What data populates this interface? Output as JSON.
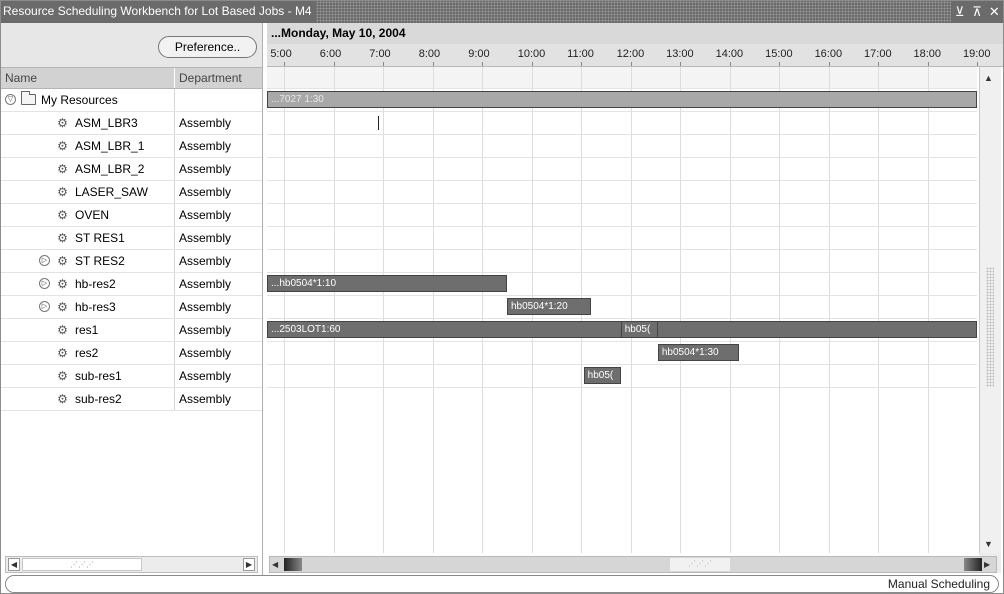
{
  "window": {
    "title": "Resource Scheduling Workbench for Lot Based Jobs - M4",
    "controls": {
      "minimize": "⊻",
      "maximize": "⊼",
      "close": "✕"
    }
  },
  "left_pane": {
    "preference_label": "Preference..",
    "columns": {
      "name": "Name",
      "department": "Department"
    },
    "root": {
      "label": "My Resources",
      "icon": "folder-icon"
    },
    "resources": [
      {
        "name": "ASM_LBR3",
        "department": "Assembly",
        "expandable": false
      },
      {
        "name": "ASM_LBR_1",
        "department": "Assembly",
        "expandable": false
      },
      {
        "name": "ASM_LBR_2",
        "department": "Assembly",
        "expandable": false
      },
      {
        "name": "LASER_SAW",
        "department": "Assembly",
        "expandable": false
      },
      {
        "name": "OVEN",
        "department": "Assembly",
        "expandable": false
      },
      {
        "name": "ST RES1",
        "department": "Assembly",
        "expandable": false
      },
      {
        "name": "ST RES2",
        "department": "Assembly",
        "expandable": true
      },
      {
        "name": "hb-res2",
        "department": "Assembly",
        "expandable": true
      },
      {
        "name": "hb-res3",
        "department": "Assembly",
        "expandable": true
      },
      {
        "name": "res1",
        "department": "Assembly",
        "expandable": false
      },
      {
        "name": "res2",
        "department": "Assembly",
        "expandable": false
      },
      {
        "name": "sub-res1",
        "department": "Assembly",
        "expandable": false
      },
      {
        "name": "sub-res2",
        "department": "Assembly",
        "expandable": false
      }
    ]
  },
  "gantt": {
    "date_label": "...Monday, May 10, 2004",
    "start_hour": 4.65,
    "end_hour": 19.0,
    "hours": [
      {
        "h": 5,
        "label": "5:00"
      },
      {
        "h": 6,
        "label": "6:00"
      },
      {
        "h": 7,
        "label": "7:00"
      },
      {
        "h": 8,
        "label": "8:00"
      },
      {
        "h": 9,
        "label": "9:00"
      },
      {
        "h": 10,
        "label": "10:00"
      },
      {
        "h": 11,
        "label": "11:00"
      },
      {
        "h": 12,
        "label": "12:00"
      },
      {
        "h": 13,
        "label": "13:00"
      },
      {
        "h": 14,
        "label": "14:00"
      },
      {
        "h": 15,
        "label": "15:00"
      },
      {
        "h": 16,
        "label": "16:00"
      },
      {
        "h": 17,
        "label": "17:00"
      },
      {
        "h": 18,
        "label": "18:00"
      },
      {
        "h": 19,
        "label": "19:00"
      }
    ],
    "bars": [
      {
        "row": 0,
        "start": 4.65,
        "end": 19.0,
        "label": "...7027 1:30",
        "style": "light"
      },
      {
        "row": 8,
        "start": 4.65,
        "end": 9.5,
        "label": "...hb0504*1:10",
        "style": "dark"
      },
      {
        "row": 9,
        "start": 9.5,
        "end": 11.2,
        "label": "hb0504*1:20",
        "style": "dark"
      },
      {
        "row": 10,
        "start": 4.65,
        "end": 19.0,
        "label": "...2503LOT1:60",
        "style": "dark"
      },
      {
        "row": 10,
        "start": 11.8,
        "end": 12.55,
        "label": "hb05(",
        "style": "dark"
      },
      {
        "row": 11,
        "start": 12.55,
        "end": 14.2,
        "label": "hb0504*1:30",
        "style": "dark"
      },
      {
        "row": 12,
        "start": 11.05,
        "end": 11.8,
        "label": "hb05(",
        "style": "dark"
      }
    ],
    "cursor": {
      "row": 1,
      "hour": 6.9
    }
  },
  "status": {
    "mode": "Manual Scheduling"
  }
}
